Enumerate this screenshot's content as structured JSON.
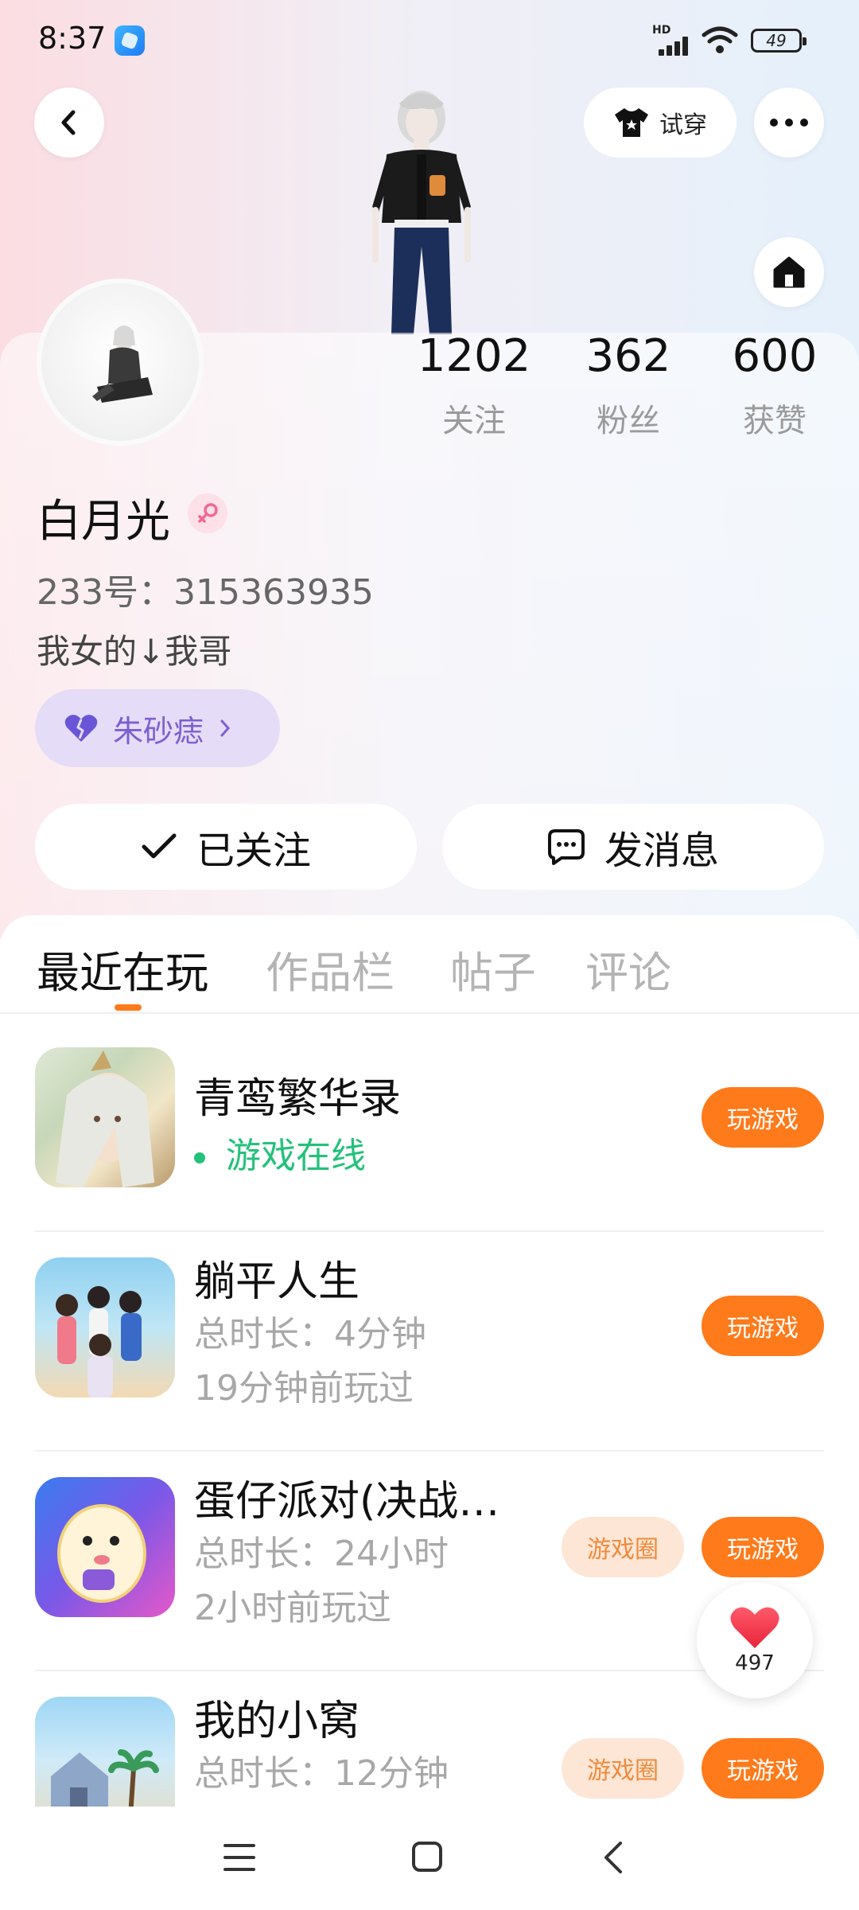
{
  "status_bar": {
    "time": "8:37",
    "signal_label": "HD",
    "battery": "49"
  },
  "header": {
    "tryon_label": "试穿"
  },
  "profile": {
    "stats": [
      {
        "value": "1202",
        "label": "关注"
      },
      {
        "value": "362",
        "label": "粉丝"
      },
      {
        "value": "600",
        "label": "获赞"
      }
    ],
    "name": "白月光",
    "uid": "233号：315363935",
    "bio": "我女的↓我哥",
    "tag": "朱砂痣",
    "follow_label": "已关注",
    "message_label": "发消息"
  },
  "tabs": [
    "最近在玩",
    "作品栏",
    "帖子",
    "评论"
  ],
  "games": [
    {
      "title": "青鸾繁华录",
      "status": "游戏在线",
      "play_label": "玩游戏"
    },
    {
      "title": "躺平人生",
      "duration": "总时长：4分钟",
      "last_played": "19分钟前玩过",
      "play_label": "玩游戏"
    },
    {
      "title": "蛋仔派对(决战…",
      "duration": "总时长：24小时",
      "last_played": "2小时前玩过",
      "circle_label": "游戏圈",
      "play_label": "玩游戏"
    },
    {
      "title": "我的小窝",
      "duration": "总时长：12分钟",
      "circle_label": "游戏圈",
      "play_label": "玩游戏"
    }
  ],
  "like_count": "497",
  "colors": {
    "accent": "#ff7a1a",
    "online": "#24c17a",
    "tag_bg": "#e5dcf7",
    "tag_text": "#7b5fd0"
  }
}
